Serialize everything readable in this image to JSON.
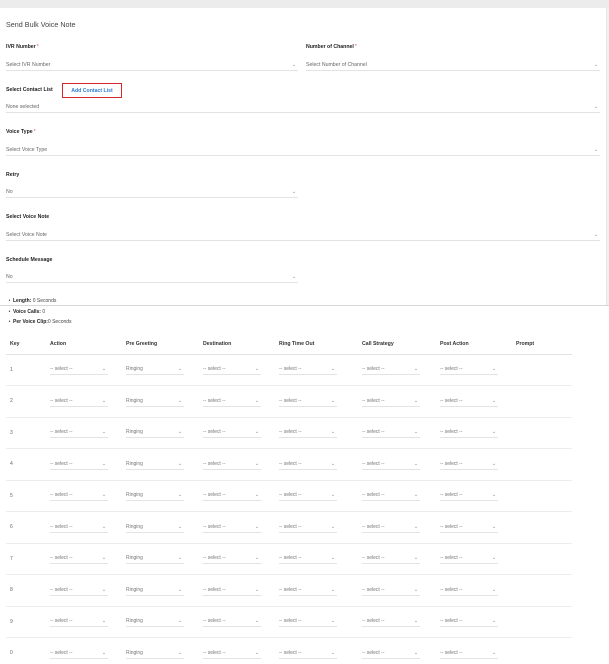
{
  "page_title": "Send Bulk Voice Note",
  "form": {
    "ivr_number": {
      "label": "IVR Number",
      "required": "*",
      "placeholder": "Select IVR Number"
    },
    "number_of_channel": {
      "label": "Number of Channel",
      "required": "*",
      "placeholder": "Select Number of Channel"
    },
    "contact_list": {
      "label": "Select Contact List",
      "add_link": "Add Contact List",
      "value": "None selected"
    },
    "voice_type": {
      "label": "Voice Type",
      "required": "*",
      "placeholder": "Select Voice Type"
    },
    "retry": {
      "label": "Retry",
      "value": "No"
    },
    "voice_note": {
      "label": "Select Voice Note",
      "placeholder": "Select Voice Note"
    },
    "schedule": {
      "label": "Schedule Message",
      "value": "No"
    }
  },
  "info": {
    "length_label": "Length:",
    "length_value": "0 Seconds",
    "calls_label": "Voice Calls:",
    "calls_value": "0",
    "clip_label": "Per Voice Clip:",
    "clip_value": "0 Seconds"
  },
  "table": {
    "headers": [
      "Key",
      "Action",
      "Pre Greeting",
      "Destination",
      "Ring Time Out",
      "Call Strategy",
      "Post Action",
      "Prompt"
    ],
    "rows": [
      {
        "key": "1",
        "action": "-- select --",
        "pre_greeting": "Ringing",
        "destination": "-- select --",
        "ring_timeout": "-- select --",
        "call_strategy": "-- select --",
        "post_action": "-- select --"
      },
      {
        "key": "2",
        "action": "-- select --",
        "pre_greeting": "Ringing",
        "destination": "-- select --",
        "ring_timeout": "-- select --",
        "call_strategy": "-- select --",
        "post_action": "-- select --"
      },
      {
        "key": "3",
        "action": "-- select --",
        "pre_greeting": "Ringing",
        "destination": "-- select --",
        "ring_timeout": "-- select --",
        "call_strategy": "-- select --",
        "post_action": "-- select --"
      },
      {
        "key": "4",
        "action": "-- select --",
        "pre_greeting": "Ringing",
        "destination": "-- select --",
        "ring_timeout": "-- select --",
        "call_strategy": "-- select --",
        "post_action": "-- select --"
      },
      {
        "key": "5",
        "action": "-- select --",
        "pre_greeting": "Ringing",
        "destination": "-- select --",
        "ring_timeout": "-- select --",
        "call_strategy": "-- select --",
        "post_action": "-- select --"
      },
      {
        "key": "6",
        "action": "-- select --",
        "pre_greeting": "Ringing",
        "destination": "-- select --",
        "ring_timeout": "-- select --",
        "call_strategy": "-- select --",
        "post_action": "-- select --"
      },
      {
        "key": "7",
        "action": "-- select --",
        "pre_greeting": "Ringing",
        "destination": "-- select --",
        "ring_timeout": "-- select --",
        "call_strategy": "-- select --",
        "post_action": "-- select --"
      },
      {
        "key": "8",
        "action": "-- select --",
        "pre_greeting": "Ringing",
        "destination": "-- select --",
        "ring_timeout": "-- select --",
        "call_strategy": "-- select --",
        "post_action": "-- select --"
      },
      {
        "key": "9",
        "action": "-- select --",
        "pre_greeting": "Ringing",
        "destination": "-- select --",
        "ring_timeout": "-- select --",
        "call_strategy": "-- select --",
        "post_action": "-- select --"
      },
      {
        "key": "0",
        "action": "-- select --",
        "pre_greeting": "Ringing",
        "destination": "-- select --",
        "ring_timeout": "-- select --",
        "call_strategy": "-- select --",
        "post_action": "-- select --"
      }
    ]
  },
  "icons": {
    "dropdown": "chevron-down-icon"
  },
  "colors": {
    "required": "#e84a4a",
    "link": "#2f7fd1",
    "highlight_border": "#d9262c"
  }
}
